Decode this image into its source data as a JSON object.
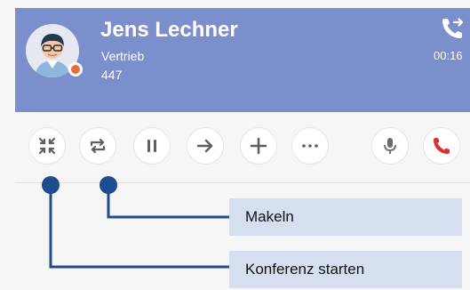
{
  "contact": {
    "name": "Jens Lechner",
    "department": "Vertrieb",
    "extension": "447",
    "status_color": "#ef6a3a"
  },
  "call": {
    "timer": "00:16",
    "header_color": "#7a8fcb"
  },
  "toolbar": {
    "buttons": [
      {
        "icon": "conference-merge-icon"
      },
      {
        "icon": "swap-calls-icon"
      },
      {
        "icon": "pause-icon"
      },
      {
        "icon": "arrow-right-icon"
      },
      {
        "icon": "plus-icon"
      },
      {
        "icon": "more-dots-icon"
      },
      {
        "icon": "microphone-icon"
      },
      {
        "icon": "hangup-icon",
        "color": "#d9342b"
      }
    ]
  },
  "callouts": {
    "makeln": "Makeln",
    "konferenz": "Konferenz starten",
    "line_color": "#1e4c8f",
    "box_color": "#d6dff0"
  }
}
